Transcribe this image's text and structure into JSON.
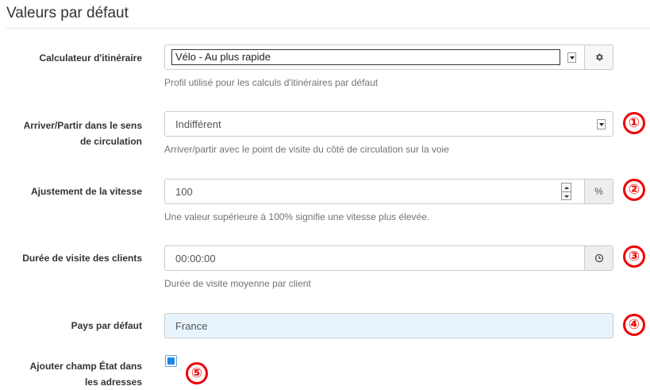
{
  "section": {
    "title": "Valeurs par défaut"
  },
  "fields": {
    "calculator": {
      "label": "Calculateur d'itinéraire",
      "value": "Vélo - Au plus rapide",
      "help": "Profil utilisé pour les calculs d'itinéraires par défaut",
      "settings_icon": "gear-icon"
    },
    "side_of_street": {
      "label_line1": "Arriver/Partir dans le sens",
      "label_line2": "de circulation",
      "value": "Indifférent",
      "help": "Arriver/partir avec le point de visite du côté de circulation sur la voie"
    },
    "speed_adjust": {
      "label": "Ajustement de la vitesse",
      "value": "100",
      "unit": "%",
      "help": "Une valeur supérieure à 100% signifie une vitesse plus élevée."
    },
    "visit_duration": {
      "label": "Durée de visite des clients",
      "value": "00:00:00",
      "icon": "clock-icon",
      "help": "Durée de visite moyenne par client"
    },
    "default_country": {
      "label": "Pays par défaut",
      "value": "France"
    },
    "state_field": {
      "label_line1": "Ajouter champ État dans",
      "label_line2": "les adresses",
      "checked": true
    }
  },
  "annotations": [
    "①",
    "②",
    "③",
    "④",
    "⑤"
  ],
  "colors": {
    "annotation": "#e00000",
    "country_bg": "#e8f4fd",
    "checkbox": "#1e88e5"
  }
}
